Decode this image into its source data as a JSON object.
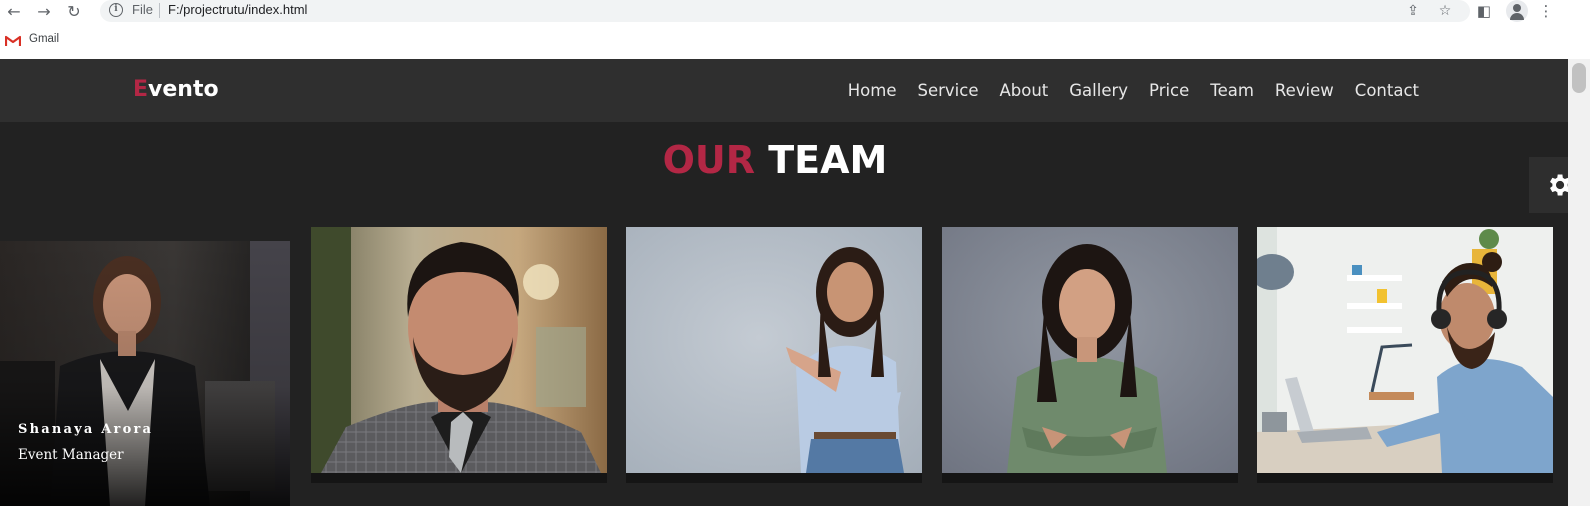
{
  "browser": {
    "scheme_label": "File",
    "url": "F:/projectrutu/index.html",
    "bookmarks": [
      {
        "label": "Gmail"
      }
    ]
  },
  "site": {
    "logo_first": "E",
    "logo_rest": "vento",
    "nav": [
      "Home",
      "Service",
      "About",
      "Gallery",
      "Price",
      "Team",
      "Review",
      "Contact"
    ]
  },
  "team": {
    "title_red": "OUR",
    "title_white": "TEAM",
    "members": [
      {
        "name": "Shanaya Arora",
        "role": "Event Manager"
      }
    ]
  },
  "colors": {
    "accent": "#b32745",
    "page_bg": "#222222",
    "header_bg": "#2f2f2f"
  },
  "icons": {
    "settings": "gear-icon"
  }
}
